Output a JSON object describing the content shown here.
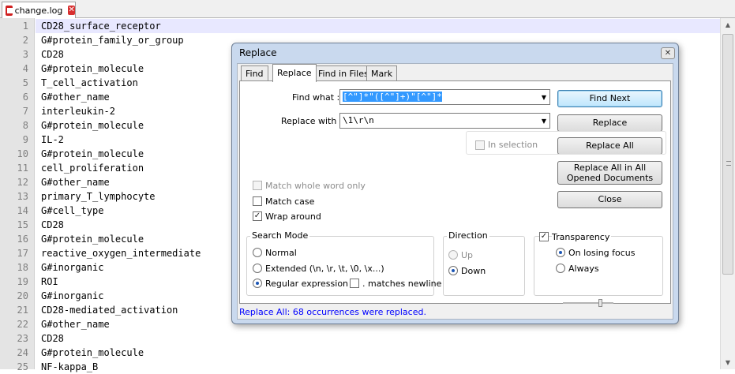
{
  "tab": {
    "filename": "change.log",
    "close_glyph": "✕"
  },
  "editor": {
    "lines": [
      {
        "num": "1",
        "text": "CD28_surface_receptor"
      },
      {
        "num": "2",
        "text": "G#protein_family_or_group"
      },
      {
        "num": "3",
        "text": "CD28"
      },
      {
        "num": "4",
        "text": "G#protein_molecule"
      },
      {
        "num": "5",
        "text": "T_cell_activation"
      },
      {
        "num": "6",
        "text": "G#other_name"
      },
      {
        "num": "7",
        "text": "interleukin-2"
      },
      {
        "num": "8",
        "text": "G#protein_molecule"
      },
      {
        "num": "9",
        "text": "IL-2"
      },
      {
        "num": "10",
        "text": "G#protein_molecule"
      },
      {
        "num": "11",
        "text": "cell_proliferation"
      },
      {
        "num": "12",
        "text": "G#other_name"
      },
      {
        "num": "13",
        "text": "primary_T_lymphocyte"
      },
      {
        "num": "14",
        "text": "G#cell_type"
      },
      {
        "num": "15",
        "text": "CD28"
      },
      {
        "num": "16",
        "text": "G#protein_molecule"
      },
      {
        "num": "17",
        "text": "reactive_oxygen_intermediate"
      },
      {
        "num": "18",
        "text": "G#inorganic"
      },
      {
        "num": "19",
        "text": "ROI"
      },
      {
        "num": "20",
        "text": "G#inorganic"
      },
      {
        "num": "21",
        "text": "CD28-mediated_activation"
      },
      {
        "num": "22",
        "text": "G#other_name"
      },
      {
        "num": "23",
        "text": "CD28"
      },
      {
        "num": "24",
        "text": "G#protein_molecule"
      },
      {
        "num": "25",
        "text": "NF-kappa_B"
      }
    ]
  },
  "dialog": {
    "title": "Replace",
    "close_glyph": "✕",
    "tabs": [
      "Find",
      "Replace",
      "Find in Files",
      "Mark"
    ],
    "active_tab": "Replace",
    "find_what_label": "Find what :",
    "find_what_value": "[^\"]*\"([^\"]+)\"[^\"]*",
    "replace_with_label": "Replace with :",
    "replace_with_value": "\\1\\r\\n",
    "buttons": {
      "find_next": "Find Next",
      "replace": "Replace",
      "replace_all": "Replace All",
      "replace_all_opened": "Replace All in All Opened Documents",
      "close": "Close"
    },
    "in_selection": {
      "label": "In selection",
      "checked": false,
      "enabled": false
    },
    "options": {
      "match_whole_word": {
        "label": "Match whole word only",
        "checked": false,
        "enabled": false
      },
      "match_case": {
        "label": "Match case",
        "checked": false
      },
      "wrap_around": {
        "label": "Wrap around",
        "checked": true
      }
    },
    "search_mode": {
      "title": "Search Mode",
      "normal": "Normal",
      "extended": "Extended (\\n, \\r, \\t, \\0, \\x...)",
      "regex": "Regular expression",
      "matches_newline": ". matches newline",
      "selected": "regex"
    },
    "direction": {
      "title": "Direction",
      "up": "Up",
      "down": "Down",
      "selected": "down"
    },
    "transparency": {
      "title": "Transparency",
      "checked": true,
      "on_losing_focus": "On losing focus",
      "always": "Always",
      "selected": "on_losing_focus",
      "level": 0.75
    },
    "status": "Replace All: 68 occurrences were replaced."
  },
  "colors": {
    "status_text": "#0000ff",
    "current_line": "#e8e8ff",
    "selection": "#3399ff"
  }
}
